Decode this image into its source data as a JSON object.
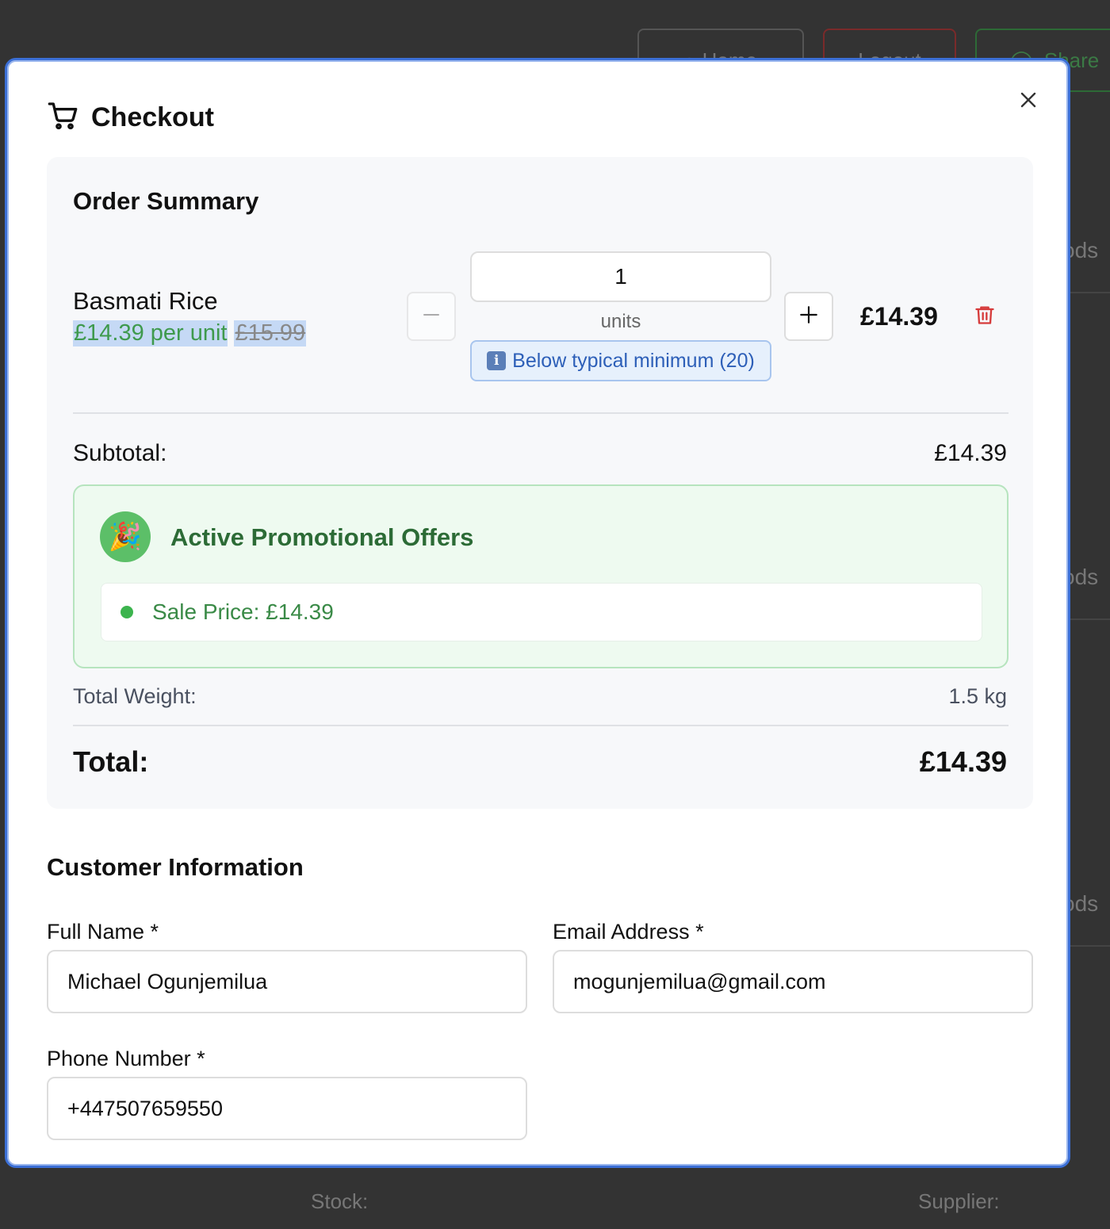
{
  "background": {
    "buttons": [
      {
        "label": "Home",
        "icon": "chevron-left-icon"
      },
      {
        "label": "Logout",
        "icon": ""
      },
      {
        "label": "Share",
        "icon": "user-icon"
      }
    ],
    "side_text": [
      "ods",
      "ods",
      "ods"
    ],
    "stock_label": "Stock:",
    "supplier_label": "Supplier:"
  },
  "modal": {
    "title": "Checkout",
    "icon": "cart-icon",
    "close_icon": "close-icon"
  },
  "summary": {
    "title": "Order Summary",
    "item": {
      "name": "Basmati Rice",
      "price_per_unit": "£14.39 per unit",
      "original_price": "£15.99",
      "quantity": "1",
      "unit_label": "units",
      "min_note": "Below typical minimum (20)",
      "info_icon": "info-icon",
      "line_total": "£14.39",
      "decrement_icon": "minus-icon",
      "increment_icon": "plus-icon",
      "delete_icon": "trash-icon"
    },
    "subtotal_label": "Subtotal:",
    "subtotal_value": "£14.39",
    "promo": {
      "title": "Active Promotional Offers",
      "icon": "party-popper-icon",
      "items": [
        "Sale Price: £14.39"
      ]
    },
    "weight_label": "Total Weight:",
    "weight_value": "1.5 kg",
    "total_label": "Total:",
    "total_value": "£14.39"
  },
  "customer": {
    "title": "Customer Information",
    "full_name_label": "Full Name *",
    "full_name_value": "Michael Ogunjemilua",
    "email_label": "Email Address *",
    "email_value": "mogunjemilua@gmail.com",
    "phone_label": "Phone Number *",
    "phone_value": "+447507659550"
  },
  "colors": {
    "accent_border": "#3b6fd6",
    "promo_green": "#2c6b36",
    "price_green": "#3f9a4d",
    "delete_red": "#d63b3b",
    "info_blue": "#2d5fb8"
  }
}
